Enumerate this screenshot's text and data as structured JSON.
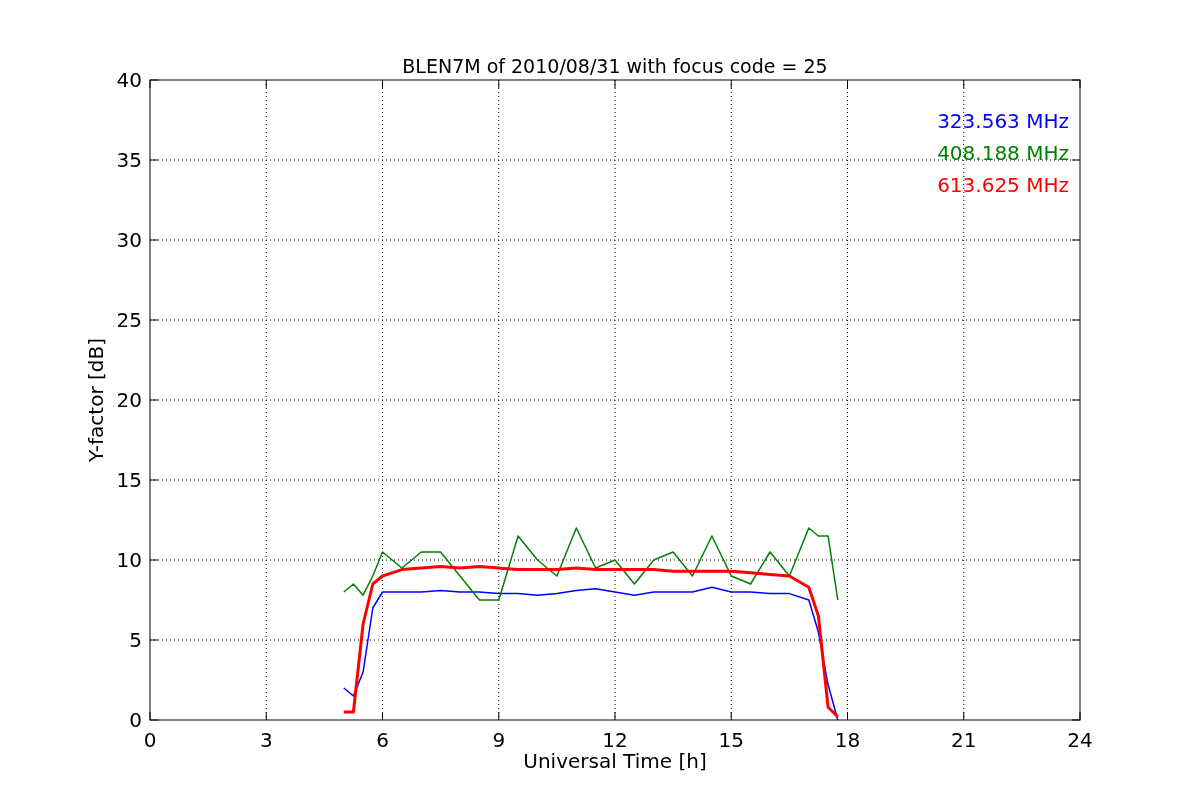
{
  "figure": {
    "chart_data": {
      "type": "line",
      "title": "BLEN7M of 2010/08/31 with focus code = 25",
      "xlabel": "Universal Time [h]",
      "ylabel": "Y-factor [dB]",
      "xlim": [
        0,
        24
      ],
      "ylim": [
        0,
        40
      ],
      "xticks": [
        0,
        3,
        6,
        9,
        12,
        15,
        18,
        21,
        24
      ],
      "yticks": [
        0,
        5,
        10,
        15,
        20,
        25,
        30,
        35,
        40
      ],
      "grid": true,
      "x": [
        5,
        5.25,
        5.5,
        5.75,
        6,
        6.5,
        7,
        7.5,
        8,
        8.5,
        9,
        9.5,
        10,
        10.5,
        11,
        11.5,
        12,
        12.5,
        13,
        13.5,
        14,
        14.5,
        15,
        15.5,
        16,
        16.5,
        17,
        17.25,
        17.5,
        17.75
      ],
      "series": [
        {
          "name": "323.563 MHz",
          "color": "#0000ff",
          "values": [
            2,
            1.5,
            3,
            7,
            8,
            8,
            8,
            8.1,
            8,
            8,
            7.9,
            7.9,
            7.8,
            7.9,
            8.1,
            8.2,
            8,
            7.8,
            8,
            8,
            8,
            8.3,
            8,
            8,
            7.9,
            7.9,
            7.5,
            5.5,
            2.2,
            0
          ]
        },
        {
          "name": "408.188 MHz",
          "color": "#008000",
          "values": [
            8,
            8.5,
            7.8,
            9,
            10.5,
            9.5,
            10.5,
            10.5,
            9,
            7.5,
            7.5,
            11.5,
            10,
            9,
            12,
            9.5,
            10,
            8.5,
            10,
            10.5,
            9,
            11.5,
            9,
            8.5,
            10.5,
            9,
            12,
            11.5,
            11.5,
            7.5
          ]
        },
        {
          "name": "613.625 MHz",
          "color": "#ff0000",
          "values": [
            0.5,
            0.5,
            6,
            8.5,
            9,
            9.4,
            9.5,
            9.6,
            9.5,
            9.6,
            9.5,
            9.4,
            9.4,
            9.4,
            9.5,
            9.4,
            9.4,
            9.4,
            9.4,
            9.3,
            9.3,
            9.3,
            9.3,
            9.2,
            9.1,
            9,
            8.3,
            6.5,
            0.8,
            0.2
          ]
        }
      ]
    }
  }
}
